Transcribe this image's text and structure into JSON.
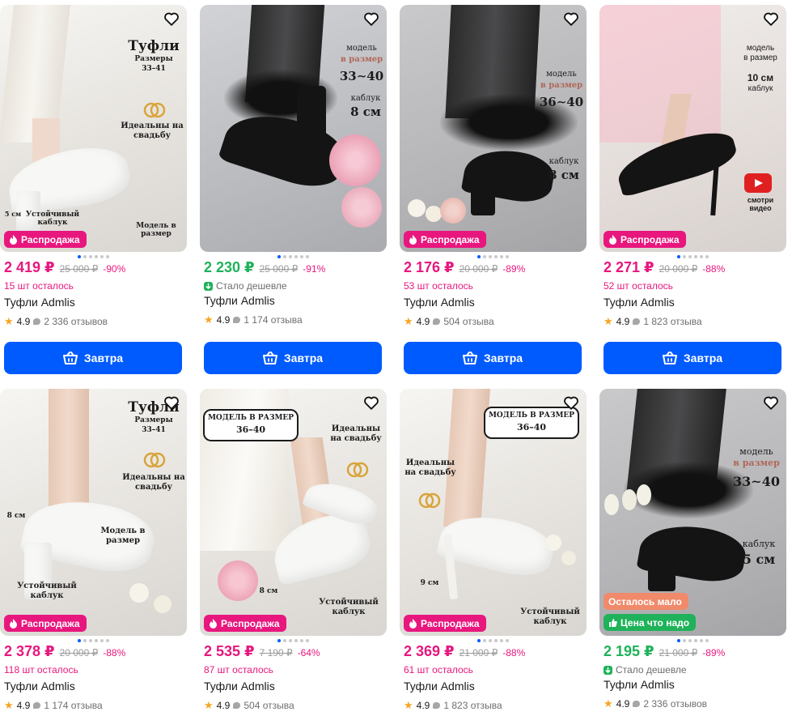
{
  "colors": {
    "accent": "#005bff",
    "sale": "#e8177e",
    "green": "#1fb25a",
    "little": "#f08a6a"
  },
  "icons": {
    "favorite": "heart-outline-icon",
    "sale": "fire-icon",
    "cart": "basket-icon",
    "rating": "star-icon",
    "reviews": "speech-bubble-icon"
  },
  "products": [
    {
      "price": "2 419 ₽",
      "old_price": "25 000 ₽",
      "discount": "-90%",
      "status": "15 шт осталось",
      "status_type": "stock",
      "name": "Туфли Admlis",
      "rating": "4.9",
      "reviews": "2 336 отзывов",
      "badge": "Распродажа",
      "button": "Завтра",
      "overlay": {
        "title": "Туфли",
        "sizes": "Размеры",
        "sizes_range": "33–41",
        "wedding": "Идеальны на свадьбу",
        "heel_height": "5 см",
        "heel_label": "Устойчивый каблук",
        "model": "Модель в размер"
      }
    },
    {
      "price": "2 230 ₽",
      "old_price": "25 000 ₽",
      "discount": "-91%",
      "status": "Стало дешевле",
      "status_type": "cheaper",
      "name": "Туфли Admlis",
      "rating": "4.9",
      "reviews": "1 174 отзыва",
      "button": "Завтра",
      "overlay": {
        "model": "модель",
        "in_size": "в размер",
        "size_range": "33∼40",
        "heel": "каблук",
        "heel_height": "8 см"
      }
    },
    {
      "price": "2 176 ₽",
      "old_price": "20 000 ₽",
      "discount": "-89%",
      "status": "53 шт осталось",
      "status_type": "stock",
      "name": "Туфли Admlis",
      "rating": "4.9",
      "reviews": "504 отзыва",
      "badge": "Распродажа",
      "button": "Завтра",
      "overlay": {
        "model": "модель",
        "in_size": "в размер",
        "size_range": "36∼40",
        "heel": "каблук",
        "heel_height": "8 см"
      }
    },
    {
      "price": "2 271 ₽",
      "old_price": "20 000 ₽",
      "discount": "-88%",
      "status": "52 шт осталось",
      "status_type": "stock",
      "name": "Туфли Admlis",
      "rating": "4.9",
      "reviews": "1 823 отзыва",
      "badge": "Распродажа",
      "button": "Завтра",
      "overlay": {
        "model": "модель",
        "in_size": "в размер",
        "heel_height": "10 см",
        "heel": "каблук",
        "video": "смотри видео"
      }
    },
    {
      "price": "2 378 ₽",
      "old_price": "20 000 ₽",
      "discount": "-88%",
      "status": "118 шт осталось",
      "status_type": "stock",
      "name": "Туфли Admlis",
      "rating": "4.9",
      "reviews": "1 174 отзыва",
      "badge": "Распродажа",
      "overlay": {
        "title": "Туфли",
        "sizes": "Размеры",
        "sizes_range": "33–41",
        "wedding": "Идеальны на свадьбу",
        "heel_height": "8 см",
        "model": "Модель в размер",
        "heel_label": "Устойчивый каблук"
      }
    },
    {
      "price": "2 535 ₽",
      "old_price": "7 190 ₽",
      "discount": "-64%",
      "status": "87 шт осталось",
      "status_type": "stock",
      "name": "Туфли Admlis",
      "rating": "4.9",
      "reviews": "504 отзыва",
      "badge": "Распродажа",
      "overlay": {
        "model": "МОДЕЛЬ В РАЗМЕР",
        "size_range": "36–40",
        "wedding": "Идеальны на свадьбу",
        "heel_height": "8 см",
        "heel_label": "Устойчивый каблук"
      }
    },
    {
      "price": "2 369 ₽",
      "old_price": "21 000 ₽",
      "discount": "-88%",
      "status": "61 шт осталось",
      "status_type": "stock",
      "name": "Туфли Admlis",
      "rating": "4.9",
      "reviews": "1 823 отзыва",
      "badge": "Распродажа",
      "overlay": {
        "model": "МОДЕЛЬ В РАЗМЕР",
        "size_range": "36–40",
        "wedding": "Идеальны на свадьбу",
        "heel_height": "9 см",
        "heel_label": "Устойчивый каблук"
      }
    },
    {
      "price": "2 195 ₽",
      "old_price": "21 000 ₽",
      "discount": "-89%",
      "status": "Стало дешевле",
      "status_type": "cheaper",
      "name": "Туфли Admlis",
      "rating": "4.9",
      "reviews": "2 336 отзывов",
      "badge_little": "Осталось мало",
      "badge_price": "Цена что надо",
      "overlay": {
        "model": "модель",
        "in_size": "в размер",
        "size_range": "33∼40",
        "heel": "каблук",
        "heel_height": "5 см"
      }
    }
  ]
}
